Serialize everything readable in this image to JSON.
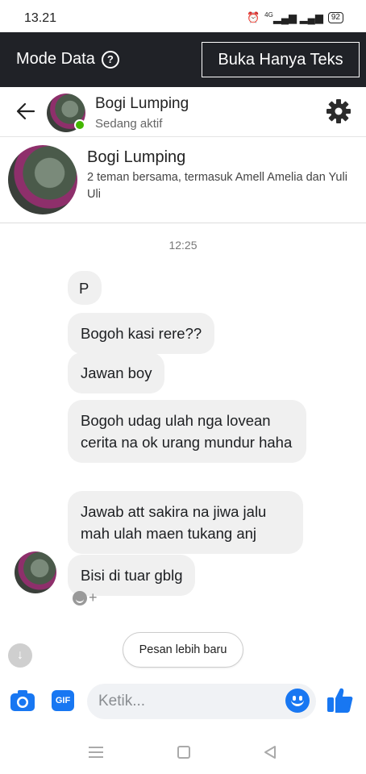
{
  "status_bar": {
    "time": "13.21",
    "signal_label": "4G",
    "battery": "92"
  },
  "data_bar": {
    "mode_label": "Mode Data",
    "text_only_button": "Buka Hanya Teks"
  },
  "header": {
    "name": "Bogi Lumping",
    "status": "Sedang aktif"
  },
  "profile": {
    "name": "Bogi Lumping",
    "mutual_friends": "2 teman bersama, termasuk Amell Amelia dan Yuli Uli"
  },
  "conversation": {
    "timestamp": "12:25",
    "messages": [
      "P",
      "Bogoh kasi rere??",
      "Jawan boy",
      "Bogoh udag ulah nga lovean cerita na ok urang mundur haha",
      "Jawab att sakira na jiwa jalu mah ulah maen tukang anj",
      "Bisi di tuar gblg"
    ],
    "reaction_add": "+",
    "newer_messages_button": "Pesan lebih baru"
  },
  "composer": {
    "placeholder": "Ketik...",
    "gif_label": "GIF"
  },
  "colors": {
    "accent": "#1877f2",
    "data_bar_bg": "#202227",
    "bubble_bg": "#f0f0f0",
    "online": "#44b700"
  },
  "icons": [
    "alarm-icon",
    "signal-icon",
    "battery-icon",
    "help-icon",
    "back-arrow-icon",
    "gear-icon",
    "scroll-down-icon",
    "camera-icon",
    "gif-icon",
    "emoji-icon",
    "like-icon",
    "nav-menu-icon",
    "nav-home-icon",
    "nav-back-icon"
  ]
}
